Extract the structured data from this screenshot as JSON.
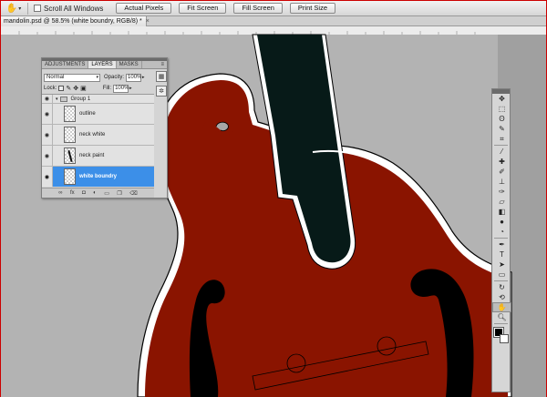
{
  "options_bar": {
    "tool_icon": "hand-icon",
    "scroll_all_windows_label": "Scroll All Windows",
    "buttons": {
      "actual_pixels": "Actual Pixels",
      "fit_screen": "Fit Screen",
      "fill_screen": "Fill Screen",
      "print_size": "Print Size"
    }
  },
  "document": {
    "tab_title": "mandolin.psd @ 58.5% (white boundry, RGB/8) *",
    "close_glyph": "×"
  },
  "layers_panel": {
    "tabs": [
      "ADJUSTMENTS",
      "LAYERS",
      "MASKS"
    ],
    "active_tab": "LAYERS",
    "blend_mode": "Normal",
    "opacity_label": "Opacity:",
    "opacity_value": "100%",
    "lock_label": "Lock:",
    "fill_label": "Fill:",
    "fill_value": "100%",
    "group_name": "Group 1",
    "layers": [
      {
        "name": "outline",
        "selected": false
      },
      {
        "name": "neck white",
        "selected": false
      },
      {
        "name": "neck paint",
        "selected": false
      },
      {
        "name": "white boundry",
        "selected": true
      }
    ],
    "footer_icons": [
      "link-icon",
      "fx-icon",
      "mask-icon",
      "adjustment-icon",
      "folder-icon",
      "new-layer-icon",
      "trash-icon"
    ]
  },
  "tools": [
    "move-icon",
    "marquee-icon",
    "lasso-icon",
    "quick-select-icon",
    "crop-icon",
    "eyedropper-icon",
    "healing-icon",
    "brush-icon",
    "clone-stamp-icon",
    "history-brush-icon",
    "eraser-icon",
    "gradient-icon",
    "blur-icon",
    "dodge-icon",
    "pen-icon",
    "type-icon",
    "path-select-icon",
    "shape-icon",
    "3d-rotate-icon",
    "3d-camera-icon",
    "hand-icon",
    "zoom-icon"
  ],
  "active_tool": "hand-icon",
  "colors": {
    "mandolin_body": "#8a1400",
    "neck": "#071a18",
    "canvas_bg": "#a7a7a7",
    "selected_layer": "#3c8fe8",
    "foreground_swatch": "#000000",
    "background_swatch": "#ffffff"
  }
}
